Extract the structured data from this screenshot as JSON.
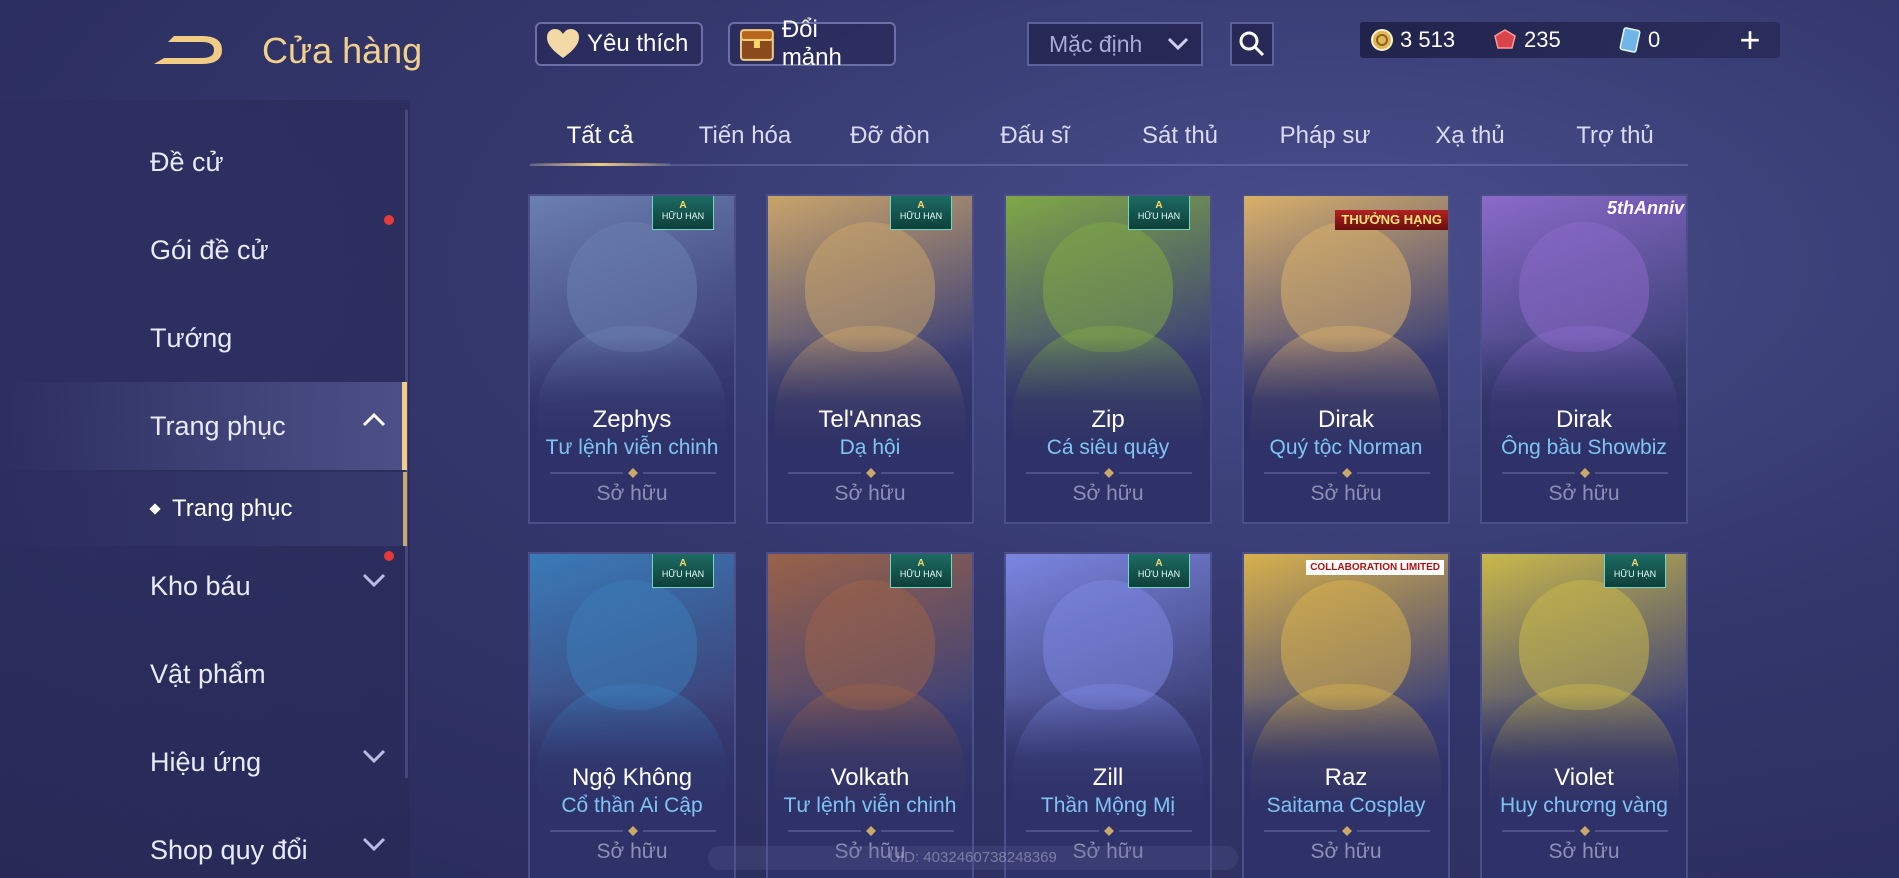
{
  "header": {
    "title": "Cửa hàng",
    "favorites_label": "Yêu thích",
    "fragments_label": "Đổi mảnh",
    "sort_value": "Mặc định"
  },
  "currency": {
    "gold": "3 513",
    "ruby": "235",
    "voucher": "0",
    "add_symbol": "+"
  },
  "sidebar": {
    "items": [
      {
        "label": "Đề cử"
      },
      {
        "label": "Gói đề cử"
      },
      {
        "label": "Tướng"
      },
      {
        "label": "Trang phục"
      },
      {
        "label": "Kho báu"
      },
      {
        "label": "Vật phẩm"
      },
      {
        "label": "Hiệu ứng"
      },
      {
        "label": "Shop quy đổi"
      }
    ],
    "sub_item": "Trang phục"
  },
  "tabs": [
    {
      "label": "Tất cả"
    },
    {
      "label": "Tiến hóa"
    },
    {
      "label": "Đỡ đòn"
    },
    {
      "label": "Đấu sĩ"
    },
    {
      "label": "Sát thủ"
    },
    {
      "label": "Pháp sư"
    },
    {
      "label": "Xạ thủ"
    },
    {
      "label": "Trợ thủ"
    }
  ],
  "badges": {
    "limited_top": "A",
    "limited_text": "HỮU HẠN",
    "rank_text": "THƯỞNG HẠNG",
    "anniv_text": "5thAnniv",
    "collab_text": "COLLABORATION LIMITED"
  },
  "cards": [
    {
      "hero": "Zephys",
      "skin": "Tư lệnh viễn chinh",
      "status": "Sở hữu",
      "color": "#6b7fb0"
    },
    {
      "hero": "Tel'Annas",
      "skin": "Dạ hội",
      "status": "Sở hữu",
      "color": "#c9a46a"
    },
    {
      "hero": "Zip",
      "skin": "Cá siêu quậy",
      "status": "Sở hữu",
      "color": "#7fa846"
    },
    {
      "hero": "Dirak",
      "skin": "Quý tộc Norman",
      "status": "Sở hữu",
      "color": "#d9b06a"
    },
    {
      "hero": "Dirak",
      "skin": "Ông bầu Showbiz",
      "status": "Sở hữu",
      "color": "#8a6ac9"
    },
    {
      "hero": "Ngộ Không",
      "skin": "Cổ thần Ai Cập",
      "status": "Sở hữu",
      "color": "#3a7bb8"
    },
    {
      "hero": "Volkath",
      "skin": "Tư lệnh viễn chinh",
      "status": "Sở hữu",
      "color": "#9a6248"
    },
    {
      "hero": "Zill",
      "skin": "Thần Mộng Mị",
      "status": "Sở hữu",
      "color": "#7b86e0"
    },
    {
      "hero": "Raz",
      "skin": "Saitama Cosplay",
      "status": "Sở hữu",
      "color": "#d7b14c"
    },
    {
      "hero": "Violet",
      "skin": "Huy chương vàng",
      "status": "Sở hữu",
      "color": "#c9b84a"
    }
  ],
  "footer_id": "UID: 4032460738248369"
}
